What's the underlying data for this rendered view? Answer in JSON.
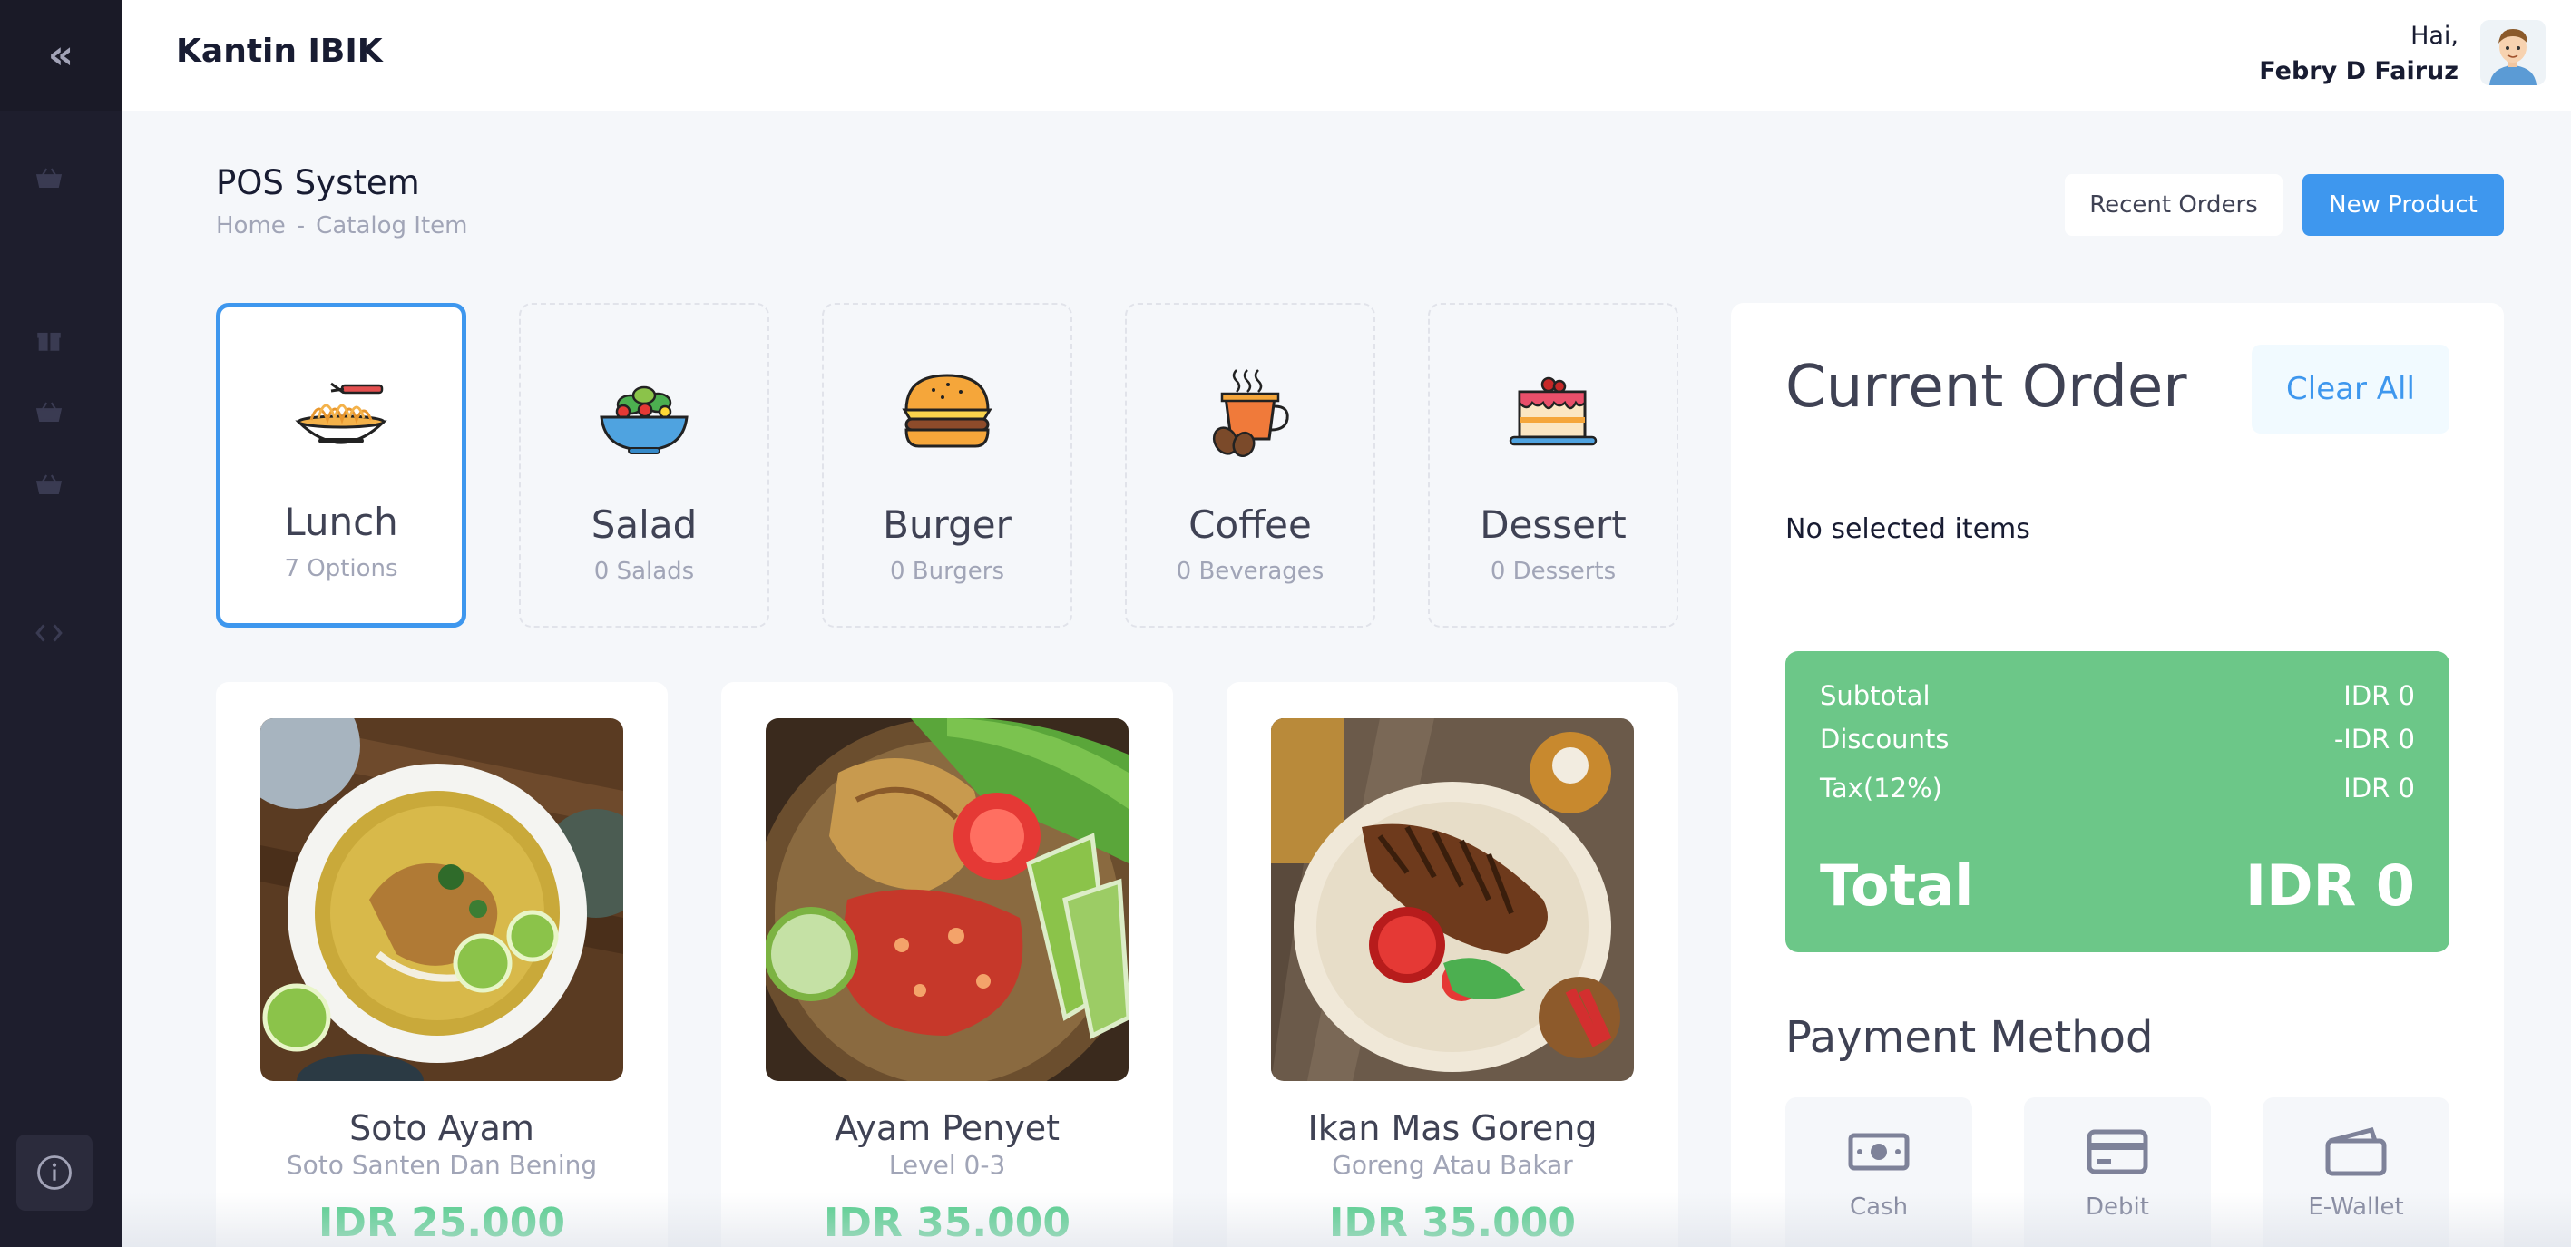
{
  "header": {
    "brand": "Kantin IBIK",
    "greeting": "Hai,",
    "user_name": "Febry D Fairuz"
  },
  "toolbar": {
    "title": "POS System",
    "breadcrumb": [
      "Home",
      "Catalog Item"
    ],
    "recent_orders_label": "Recent Orders",
    "new_product_label": "New Product"
  },
  "categories": [
    {
      "name": "Lunch",
      "count": "7 Options",
      "icon": "noodles-icon",
      "active": true
    },
    {
      "name": "Salad",
      "count": "0 Salads",
      "icon": "salad-bowl-icon",
      "active": false
    },
    {
      "name": "Burger",
      "count": "0 Burgers",
      "icon": "burger-icon",
      "active": false
    },
    {
      "name": "Coffee",
      "count": "0 Beverages",
      "icon": "coffee-cup-icon",
      "active": false
    },
    {
      "name": "Dessert",
      "count": "0 Desserts",
      "icon": "cake-icon",
      "active": false
    }
  ],
  "products": [
    {
      "name": "Soto Ayam",
      "desc": "Soto Santen Dan Bening",
      "price": "IDR 25.000"
    },
    {
      "name": "Ayam Penyet",
      "desc": "Level 0-3",
      "price": "IDR 35.000"
    },
    {
      "name": "Ikan Mas Goreng",
      "desc": "Goreng Atau Bakar",
      "price": "IDR 35.000"
    }
  ],
  "order": {
    "title": "Current Order",
    "clear_label": "Clear All",
    "empty_text": "No selected items",
    "subtotal_label": "Subtotal",
    "subtotal_value": "IDR 0",
    "discounts_label": "Discounts",
    "discounts_value": "-IDR 0",
    "tax_label": "Tax(12%)",
    "tax_value": "IDR 0",
    "total_label": "Total",
    "total_value": "IDR 0"
  },
  "payment": {
    "title": "Payment Method",
    "methods": [
      {
        "label": "Cash",
        "icon": "cash-icon"
      },
      {
        "label": "Debit",
        "icon": "credit-card-icon"
      },
      {
        "label": "E-Wallet",
        "icon": "wallet-icon"
      }
    ]
  },
  "colors": {
    "primary": "#3e97ee",
    "success": "#50cd89",
    "summary_bg": "#6cc788",
    "sidebar": "#1e1e2d"
  }
}
